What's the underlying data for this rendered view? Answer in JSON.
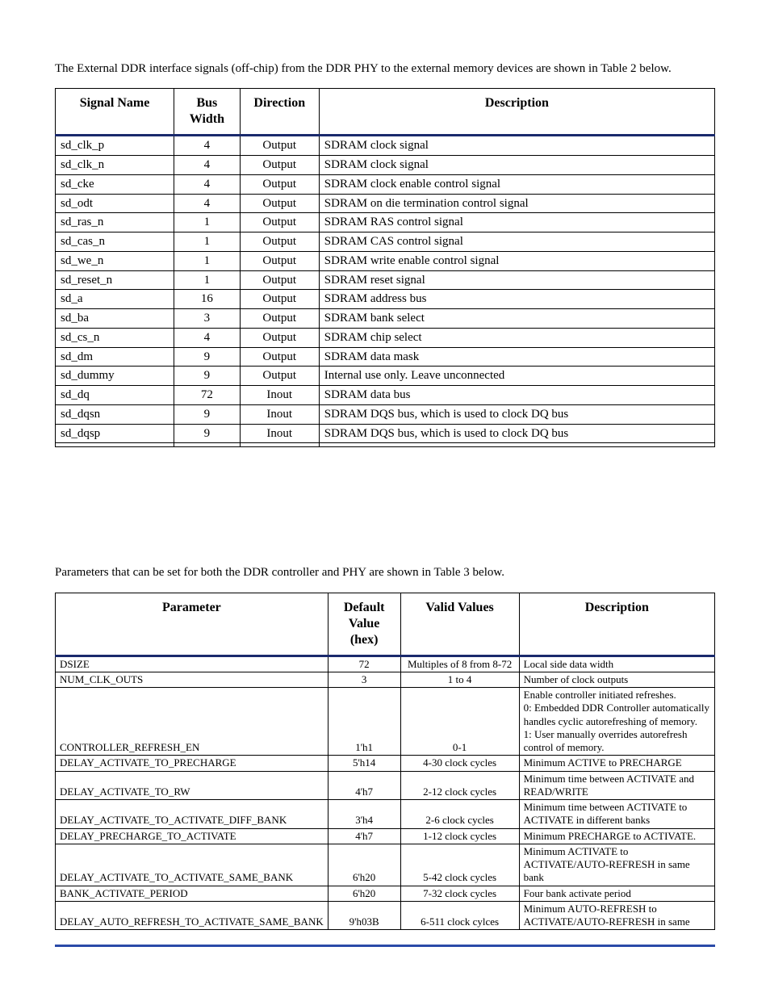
{
  "intro1": "The External DDR interface signals (off-chip) from the DDR PHY to the external memory devices are shown in Table 2 below.",
  "t1": {
    "headers": [
      "Signal Name",
      "Bus Width",
      "Direction",
      "Description"
    ],
    "rows": [
      [
        "sd_clk_p",
        "4",
        "Output",
        "SDRAM clock signal"
      ],
      [
        "sd_clk_n",
        "4",
        "Output",
        "SDRAM clock signal"
      ],
      [
        "sd_cke",
        "4",
        "Output",
        "SDRAM clock enable control signal"
      ],
      [
        "sd_odt",
        "4",
        "Output",
        "SDRAM on die termination control signal"
      ],
      [
        "sd_ras_n",
        "1",
        "Output",
        "SDRAM RAS control signal"
      ],
      [
        "sd_cas_n",
        "1",
        "Output",
        "SDRAM CAS control signal"
      ],
      [
        "sd_we_n",
        "1",
        "Output",
        "SDRAM write enable control signal"
      ],
      [
        "sd_reset_n",
        "1",
        "Output",
        "SDRAM reset signal"
      ],
      [
        "sd_a",
        "16",
        "Output",
        "SDRAM address bus"
      ],
      [
        "sd_ba",
        "3",
        "Output",
        "SDRAM bank select"
      ],
      [
        "sd_cs_n",
        "4",
        "Output",
        "SDRAM chip select"
      ],
      [
        "sd_dm",
        "9",
        "Output",
        "SDRAM data mask"
      ],
      [
        "sd_dummy",
        "9",
        "Output",
        "Internal use only. Leave unconnected"
      ],
      [
        "sd_dq",
        "72",
        "Inout",
        "SDRAM data bus"
      ],
      [
        "sd_dqsn",
        "9",
        "Inout",
        "SDRAM DQS bus, which is used to clock DQ bus"
      ],
      [
        "sd_dqsp",
        "9",
        "Inout",
        "SDRAM DQS bus, which is used to clock DQ bus"
      ],
      [
        "",
        "",
        "",
        ""
      ]
    ]
  },
  "intro2": "Parameters that can be set for both the DDR controller and PHY are shown in Table 3 below.",
  "t2": {
    "headers": [
      "Parameter",
      "Default Value (hex)",
      "Valid Values",
      "Description"
    ],
    "rows": [
      [
        "DSIZE",
        "72",
        "Multiples of 8 from 8-72",
        "Local side data width"
      ],
      [
        "NUM_CLK_OUTS",
        "3",
        "1 to 4",
        "Number of clock outputs"
      ],
      [
        "CONTROLLER_REFRESH_EN",
        "1'h1",
        "0-1",
        "Enable controller initiated refreshes.\n0:  Embedded DDR Controller automatically handles cyclic autorefreshing of memory.\n1:  User manually overrides autorefresh control of memory."
      ],
      [
        "DELAY_ACTIVATE_TO_PRECHARGE",
        "5'h14",
        "4-30 clock cycles",
        "Minimum ACTIVE to PRECHARGE"
      ],
      [
        "DELAY_ACTIVATE_TO_RW",
        "4'h7",
        "2-12 clock cycles",
        "Minimum time between ACTIVATE and READ/WRITE"
      ],
      [
        "DELAY_ACTIVATE_TO_ACTIVATE_DIFF_BANK",
        "3'h4",
        "2-6 clock cycles",
        "Minimum time between ACTIVATE to ACTIVATE in different banks"
      ],
      [
        "DELAY_PRECHARGE_TO_ACTIVATE",
        "4'h7",
        "1-12 clock cycles",
        "Minimum PRECHARGE to ACTIVATE."
      ],
      [
        "DELAY_ACTIVATE_TO_ACTIVATE_SAME_BANK",
        "6'h20",
        "5-42 clock cycles",
        "Minimum ACTIVATE to ACTIVATE/AUTO-REFRESH in same bank"
      ],
      [
        "BANK_ACTIVATE_PERIOD",
        "6'h20",
        "7-32 clock cycles",
        "Four bank activate period"
      ],
      [
        "DELAY_AUTO_REFRESH_TO_ACTIVATE_SAME_BANK",
        "9'h03B",
        "6-511 clock cylces",
        "Minimum AUTO-REFRESH to ACTIVATE/AUTO-REFRESH in same"
      ]
    ]
  }
}
